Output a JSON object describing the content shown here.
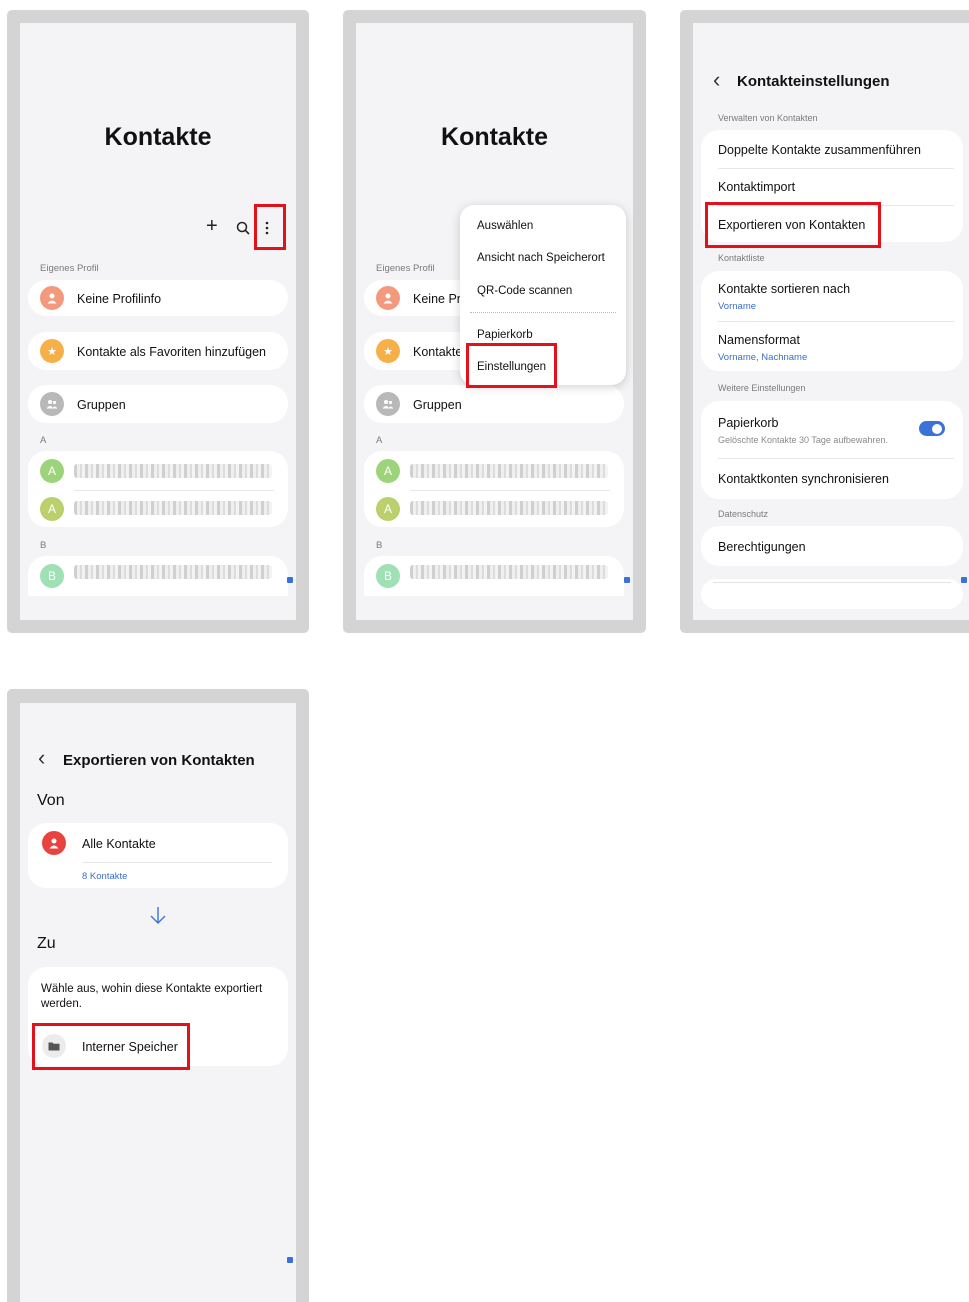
{
  "screen1": {
    "title": "Kontakte",
    "actions": {
      "add": "+",
      "search": "⌕",
      "more": "⋮"
    },
    "section_profile": "Eigenes Profil",
    "profile": "Keine Profilinfo",
    "favorites": "Kontakte als Favoriten hinzufügen",
    "groups": "Gruppen",
    "letter_a": "A",
    "letter_b": "B",
    "avatar_a": "A",
    "avatar_b": "B"
  },
  "screen2": {
    "title": "Kontakte",
    "section_profile": "Eigenes Profil",
    "profile": "Keine Pr",
    "favorites": "Kontakte",
    "groups": "Gruppen",
    "letter_a": "A",
    "letter_b": "B",
    "avatar_a": "A",
    "avatar_b": "B",
    "menu": [
      "Auswählen",
      "Ansicht nach Speicherort",
      "QR-Code scannen",
      "Papierkorb",
      "Einstellungen"
    ]
  },
  "screen3": {
    "back": "‹",
    "title": "Kontakteinstellungen",
    "section_manage": "Verwalten von Kontakten",
    "duplicates": "Doppelte Kontakte zusammenführen",
    "import": "Kontaktimport",
    "export": "Exportieren von Kontakten",
    "section_list": "Kontaktliste",
    "sort_title": "Kontakte sortieren nach",
    "sort_value": "Vorname",
    "name_format_title": "Namensformat",
    "name_format_value": "Vorname, Nachname",
    "section_more": "Weitere Einstellungen",
    "trash_title": "Papierkorb",
    "trash_sub": "Gelöschte Kontakte 30 Tage aufbewahren.",
    "trash_toggle": true,
    "sync": "Kontaktkonten synchronisieren",
    "section_privacy": "Datenschutz",
    "permissions": "Berechtigungen"
  },
  "screen4": {
    "back": "‹",
    "title": "Exportieren von Kontakten",
    "from_label": "Von",
    "all_contacts": "Alle Kontakte",
    "count": "8 Kontakte",
    "arrow": "↓",
    "to_label": "Zu",
    "instruction": "Wähle aus, wohin diese Kontakte exportiert werden.",
    "internal_storage": "Interner Speicher"
  },
  "colors": {
    "highlight": "#e3121a",
    "accent_blue": "#3a72d8",
    "profile_avatar": "#f39a7e",
    "favorites_avatar": "#f6b04a",
    "groups_avatar": "#b8b8b8",
    "contact_green": "#9dd37a",
    "contact_olive": "#bccf6d",
    "contact_mint": "#9fe0b5",
    "all_contacts_avatar": "#e8433f"
  }
}
